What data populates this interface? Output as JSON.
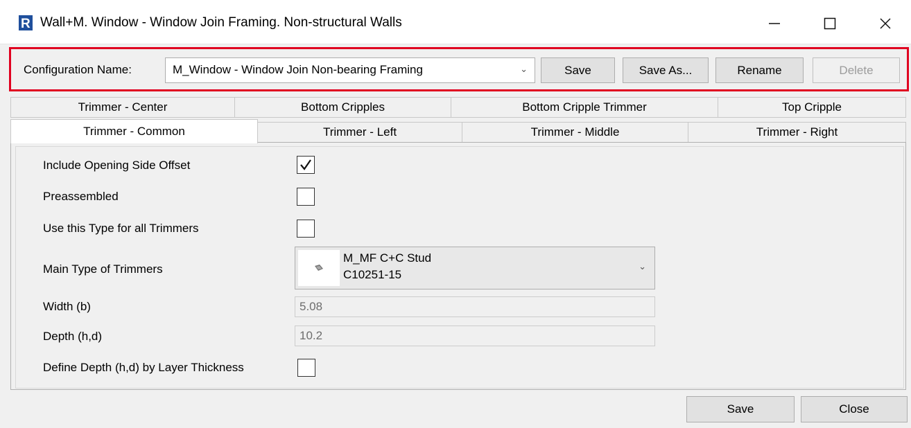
{
  "window": {
    "title": "Wall+M. Window - Window Join Framing. Non-structural Walls",
    "app_icon": "revit-r-icon",
    "controls": {
      "minimize": "—",
      "maximize": "☐",
      "close": "✕"
    }
  },
  "config": {
    "label": "Configuration Name:",
    "selected": "M_Window - Window Join Non-bearing Framing",
    "buttons": {
      "save": "Save",
      "save_as": "Save As...",
      "rename": "Rename",
      "delete": "Delete"
    }
  },
  "tabs": {
    "row1": [
      "Trimmer - Center",
      "Bottom Cripples",
      "Bottom Cripple Trimmer",
      "Top Cripple"
    ],
    "row2": [
      "Trimmer - Common",
      "Trimmer - Left",
      "Trimmer - Middle",
      "Trimmer - Right"
    ],
    "active": "Trimmer - Common"
  },
  "form": {
    "include_opening_side_offset": {
      "label": "Include Opening Side Offset",
      "checked": true
    },
    "preassembled": {
      "label": "Preassembled",
      "checked": false
    },
    "use_type_all": {
      "label": "Use this Type for all Trimmers",
      "checked": false
    },
    "main_type": {
      "label": "Main Type of Trimmers",
      "line1": "M_MF C+C Stud",
      "line2": "C10251-15"
    },
    "width": {
      "label": "Width (b)",
      "value": "5.08"
    },
    "depth": {
      "label": "Depth (h,d)",
      "value": "10.2"
    },
    "define_depth": {
      "label": "Define Depth (h,d) by Layer Thickness",
      "checked": false
    }
  },
  "footer": {
    "save": "Save",
    "close": "Close"
  },
  "colors": {
    "highlight_border": "#e00020",
    "app_icon": "#1f4f9c"
  }
}
